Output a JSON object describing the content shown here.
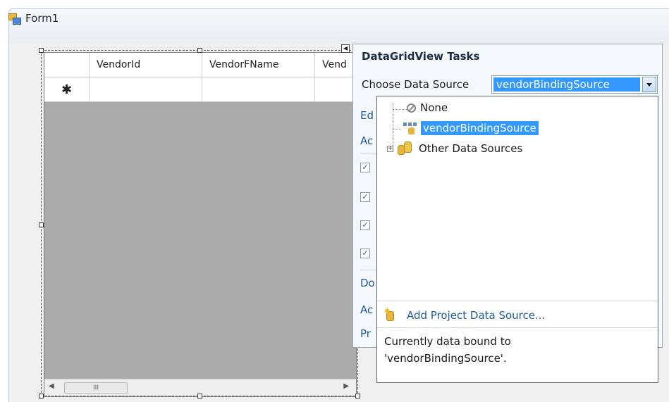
{
  "form": {
    "title": "Form1"
  },
  "grid": {
    "columns": [
      "",
      "VendorId",
      "VendorFName",
      "Vend"
    ],
    "new_row_marker": "✱",
    "scroll_thumb_label": "III"
  },
  "tasks_panel": {
    "title": "DataGridView Tasks",
    "choose_label": "Choose Data Source",
    "selected_source": "vendorBindingSource",
    "partial_items": [
      "Ed",
      "Ac",
      "Do",
      "Ac",
      "Pr"
    ],
    "checkbox_mark": "✓"
  },
  "dropdown": {
    "items": [
      {
        "label": "None",
        "icon": "none-icon"
      },
      {
        "label": "vendorBindingSource",
        "icon": "binding-source-icon"
      },
      {
        "label": "Other Data Sources",
        "icon": "database-icon"
      }
    ],
    "add_link": "Add Project Data Source...",
    "status_line1": "Currently data bound to",
    "status_line2": "'vendorBindingSource'."
  },
  "colors": {
    "selection": "#3399ff",
    "link": "#1e5aa8",
    "grid_background": "#ababab"
  }
}
